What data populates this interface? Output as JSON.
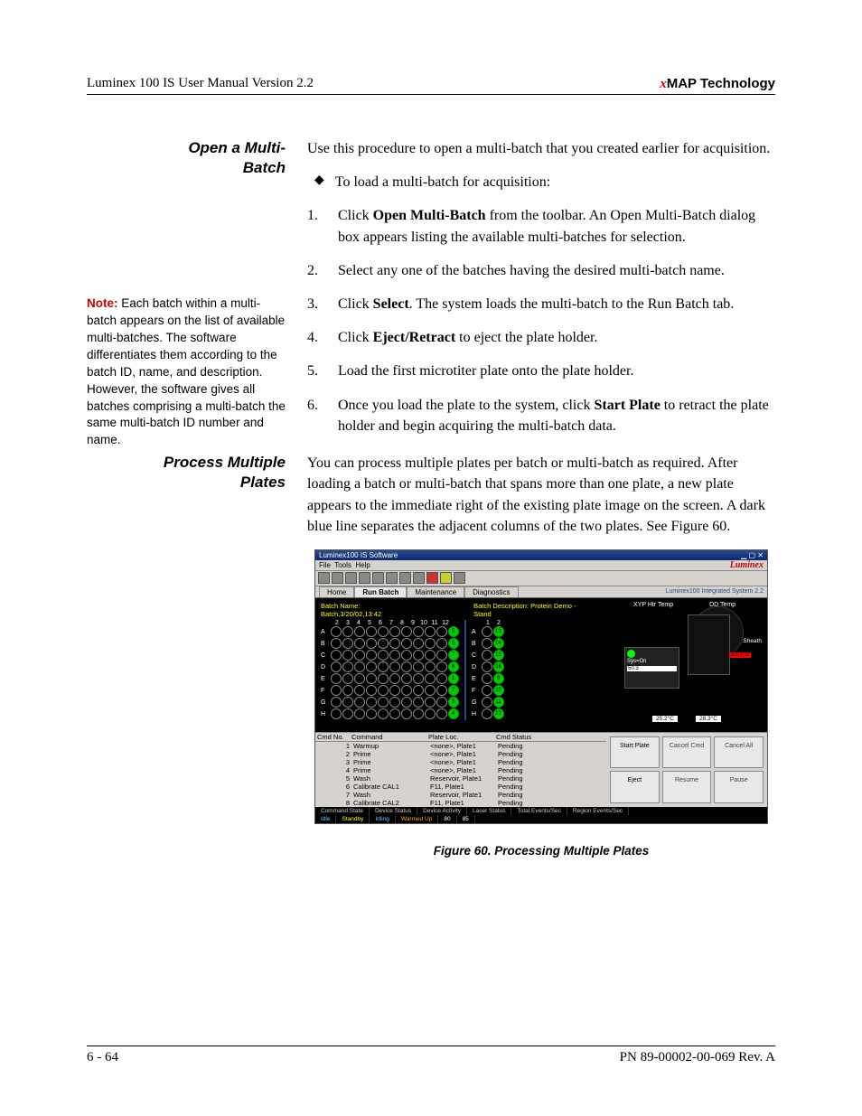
{
  "header": {
    "left": "Luminex 100 IS User Manual Version 2.2",
    "right_x": "x",
    "right_map": "MAP Technology"
  },
  "section1": {
    "title_line1": "Open a Multi-",
    "title_line2": "Batch",
    "intro": "Use this procedure to open a multi-batch that you created earlier for acquisition.",
    "bullet": "To load a multi-batch for acquisition:",
    "steps": {
      "s1_pre": "Click ",
      "s1_bold": "Open Multi-Batch",
      "s1_post": " from the toolbar. An Open Multi-Batch dialog box appears listing the available multi-batches for selection.",
      "s2": "Select any one of the batches having the desired multi-batch name.",
      "s3_pre": "Click ",
      "s3_bold": "Select",
      "s3_post": ". The system loads the multi-batch to the Run Batch tab.",
      "s4_pre": "Click ",
      "s4_bold": "Eject/Retract",
      "s4_post": " to eject the plate holder.",
      "s5": "Load the first microtiter plate onto the plate holder.",
      "s6_pre": "Once you load the plate to the system, click ",
      "s6_bold": "Start Plate",
      "s6_post": " to retract the plate holder and begin acquiring the multi-batch data."
    },
    "note_label": "Note:",
    "note_body": " Each batch within a multi-batch appears on the list of available multi-batches. The software differentiates them according to the batch ID, name, and description. However, the software gives all batches comprising a multi-batch the same multi-batch ID number and name."
  },
  "section2": {
    "title_line1": "Process Multiple",
    "title_line2": "Plates",
    "body": "You can process multiple plates per batch or multi-batch as required. After loading a batch or multi-batch that spans more than one plate, a new plate appears to the immediate right of the existing plate image on the screen. A dark blue line separates the adjacent columns of the two plates. See Figure 60."
  },
  "screenshot": {
    "title": "Luminex100 IS Software",
    "win_controls": "▁ ▢ ✕",
    "menu_file": "File",
    "menu_tools": "Tools",
    "menu_help": "Help",
    "brand": "Luminex",
    "tab_home": "Home",
    "tab_run": "Run Batch",
    "tab_maint": "Maintenance",
    "tab_diag": "Diagnostics",
    "version": "Luminex100 Integrated System 2.2",
    "batch_name_label": "Batch Name:",
    "batch_name_value": "Batch,3/20/02,13:42",
    "batch_desc_label": "Batch Description:",
    "batch_desc_value": "Protein Demo - Stand",
    "grid_cols1": [
      "2",
      "3",
      "4",
      "5",
      "6",
      "7",
      "8",
      "9",
      "10",
      "11",
      "12"
    ],
    "grid_cols2": [
      "1",
      "2"
    ],
    "grid_rows": [
      "A",
      "B",
      "C",
      "D",
      "E",
      "F",
      "G",
      "H"
    ],
    "right_nums_col1": [
      "5",
      "6",
      "7",
      "8",
      "1",
      "2",
      "3",
      "4"
    ],
    "right_nums_col2": [
      "13",
      "14",
      "15",
      "16",
      "9",
      "10",
      "11",
      "12"
    ],
    "gauge_xyp": "XYP Htr Temp",
    "gauge_dd": "DD Temp",
    "gauge_sheath": "Sheath",
    "gauge_syson": "Sys=On",
    "gauge_psi": "6.0 PSI",
    "gauge_val1": "50.3",
    "gauge_fv1": "25.2°C",
    "gauge_fv2": "28.3°C",
    "cmd_head": [
      "Cmd No.",
      "Command",
      "Plate Loc.",
      "Cmd Status"
    ],
    "cmd_rows": [
      [
        "1",
        "Warmup",
        "<none>, Plate1",
        "Pending"
      ],
      [
        "2",
        "Prime",
        "<none>, Plate1",
        "Pending"
      ],
      [
        "3",
        "Prime",
        "<none>, Plate1",
        "Pending"
      ],
      [
        "4",
        "Prime",
        "<none>, Plate1",
        "Pending"
      ],
      [
        "5",
        "Wash",
        "Reservoir, Plate1",
        "Pending"
      ],
      [
        "6",
        "Calibrate CAL1",
        "F11, Plate1",
        "Pending"
      ],
      [
        "7",
        "Wash",
        "Reservoir, Plate1",
        "Pending"
      ],
      [
        "8",
        "Calibrate CAL2",
        "F11, Plate1",
        "Pending"
      ]
    ],
    "btns": [
      "Start Plate",
      "Cancel Cmd",
      "Cancel All",
      "Eject",
      "Resume",
      "Pause"
    ],
    "status_labels": [
      "Command State",
      "Device Status",
      "Device Activity",
      "Laser Status",
      "Total Events/Sec",
      "Region Events/Sec"
    ],
    "status_vals": [
      "Idle",
      "Standby",
      "Idling",
      "Warmed Up",
      "80",
      "85"
    ]
  },
  "figure_caption": "Figure 60.  Processing Multiple Plates",
  "footer": {
    "left": "6 - 64",
    "right": "PN 89-00002-00-069 Rev. A"
  }
}
